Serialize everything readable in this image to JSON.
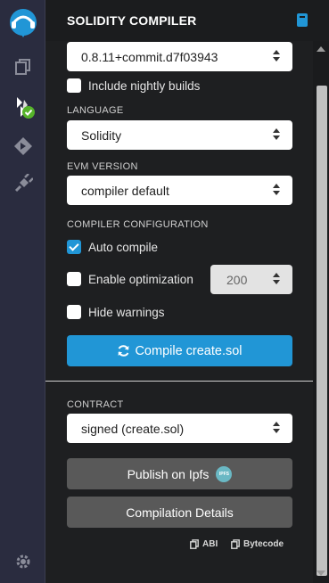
{
  "sidebar": {
    "icons": [
      {
        "name": "remix-logo"
      },
      {
        "name": "file-explorer-icon"
      },
      {
        "name": "solidity-compiler-icon"
      },
      {
        "name": "deploy-run-icon"
      },
      {
        "name": "plugin-manager-icon"
      },
      {
        "name": "settings-icon"
      }
    ]
  },
  "panel": {
    "title": "SOLIDITY COMPILER",
    "compiler_version": "0.8.11+commit.d7f03943",
    "include_nightly_label": "Include nightly builds",
    "language_label": "LANGUAGE",
    "language_value": "Solidity",
    "evm_label": "EVM VERSION",
    "evm_value": "compiler default",
    "config_label": "COMPILER CONFIGURATION",
    "auto_compile_label": "Auto compile",
    "auto_compile_checked": true,
    "enable_optimization_label": "Enable optimization",
    "enable_optimization_checked": false,
    "optimization_runs": "200",
    "hide_warnings_label": "Hide warnings",
    "hide_warnings_checked": false,
    "include_nightly_checked": false,
    "compile_button": "Compile create.sol",
    "contract_label": "CONTRACT",
    "contract_value": "signed (create.sol)",
    "publish_button": "Publish on Ipfs",
    "ipfs_badge": "IPFS",
    "details_button": "Compilation Details",
    "abi_link": "ABI",
    "bytecode_link": "Bytecode"
  },
  "colors": {
    "accent": "#2196d6",
    "rail_bg": "#2a2c3f",
    "panel_bg": "#1e1f21",
    "success": "#55b32a"
  }
}
